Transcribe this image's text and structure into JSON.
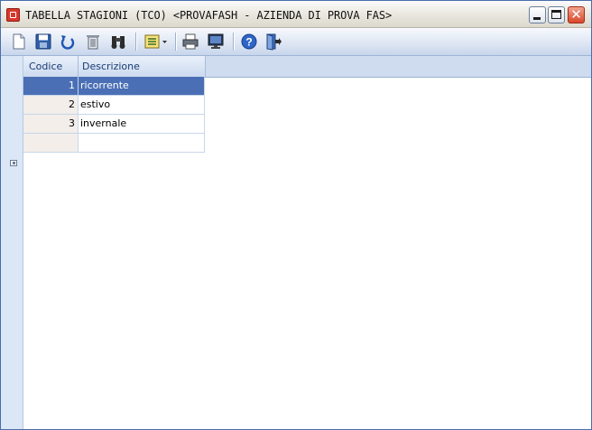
{
  "window": {
    "title": "TABELLA STAGIONI (TCO) <PROVAFASH - AZIENDA DI PROVA FAS>",
    "close_glyph": "✕"
  },
  "toolbar": {
    "icons": [
      "new-document-icon",
      "save-icon",
      "undo-icon",
      "delete-icon",
      "find-icon",
      "view-options-icon",
      "print-icon",
      "preview-icon",
      "help-icon",
      "exit-icon"
    ]
  },
  "grid": {
    "columns": [
      "Codice",
      "Descrizione"
    ],
    "rows": [
      {
        "code": "1",
        "description": "ricorrente",
        "selected": true
      },
      {
        "code": "2",
        "description": "estivo",
        "selected": false
      },
      {
        "code": "3",
        "description": "invernale",
        "selected": false
      },
      {
        "code": "",
        "description": "",
        "selected": false
      }
    ]
  },
  "colors": {
    "selection": "#4a6fb5",
    "header_text": "#1a3c72",
    "toolbar_top": "#f7f9fd",
    "toolbar_bottom": "#c7d5ec",
    "close_button": "#d8472b"
  }
}
